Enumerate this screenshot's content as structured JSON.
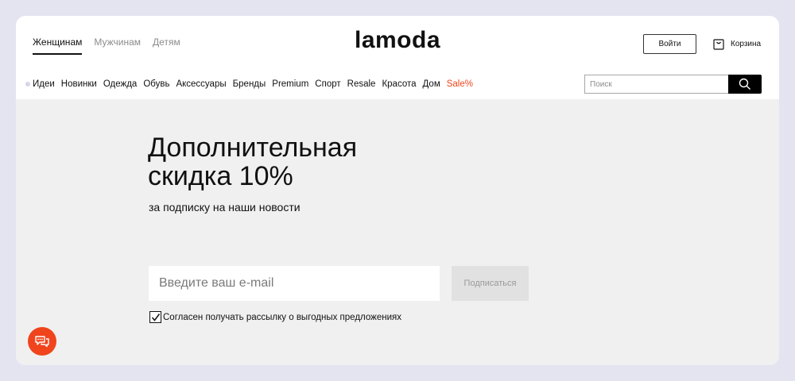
{
  "header": {
    "gender_tabs": [
      {
        "label": "Женщинам",
        "active": true
      },
      {
        "label": "Мужчинам",
        "active": false
      },
      {
        "label": "Детям",
        "active": false
      }
    ],
    "logo": "lamoda",
    "login_label": "Войти",
    "cart_label": "Корзина"
  },
  "nav": {
    "items": [
      "Идеи",
      "Новинки",
      "Одежда",
      "Обувь",
      "Аксессуары",
      "Бренды",
      "Premium",
      "Спорт",
      "Resale",
      "Красота",
      "Дом",
      "Sale%"
    ],
    "sale_color": "#f0441d"
  },
  "search": {
    "placeholder": "Поиск",
    "icon": "search-icon"
  },
  "promo": {
    "title_line1": "Дополнительная",
    "title_line2": "скидка 10%",
    "subtitle": "за подписку на наши новости",
    "email_placeholder": "Введите ваш e-mail",
    "subscribe_label": "Подписаться",
    "consent_label": "Согласен получать рассылку о выгодных предложениях",
    "consent_checked": true
  },
  "chat": {
    "icon": "chat-icon",
    "color": "#f0441d"
  }
}
